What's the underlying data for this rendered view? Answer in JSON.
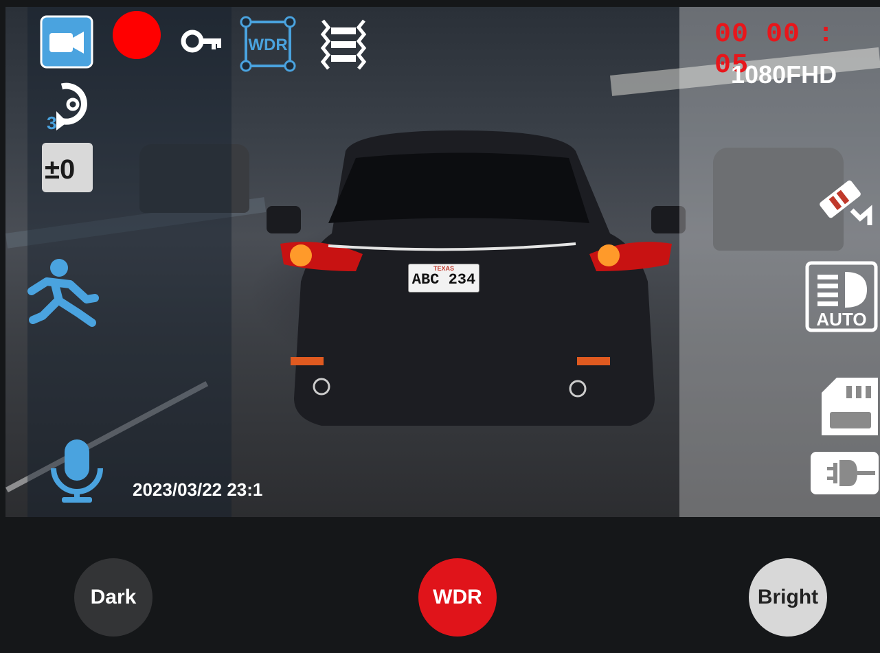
{
  "status_bar": {
    "timer": "00 00 : 05",
    "resolution": "1080FHD",
    "timestamp": "2023/03/22 23:1"
  },
  "plate": {
    "state": "TEXAS",
    "number": "ABC 234"
  },
  "left_icons": [
    {
      "name": "video-camera-icon",
      "state": "selected"
    },
    {
      "name": "record-indicator-icon",
      "color": "#ff0000"
    },
    {
      "name": "key-lock-icon"
    },
    {
      "name": "wdr-icon",
      "label": "WDR"
    },
    {
      "name": "stabilization-icon"
    },
    {
      "name": "loop-recording-icon",
      "label": "3"
    },
    {
      "name": "exposure-icon",
      "label": "±0"
    },
    {
      "name": "motion-detection-icon"
    },
    {
      "name": "microphone-icon"
    }
  ],
  "right_icons": [
    {
      "name": "parking-camera-icon"
    },
    {
      "name": "auto-headlight-icon",
      "label": "AUTO"
    },
    {
      "name": "sd-card-icon"
    },
    {
      "name": "power-plug-icon"
    }
  ],
  "buttons": {
    "dark": "Dark",
    "wdr": "WDR",
    "bright": "Bright"
  },
  "colors": {
    "accent_blue": "#4aa3df",
    "record_red": "#e8161b",
    "wdr_button": "#e0141a"
  }
}
